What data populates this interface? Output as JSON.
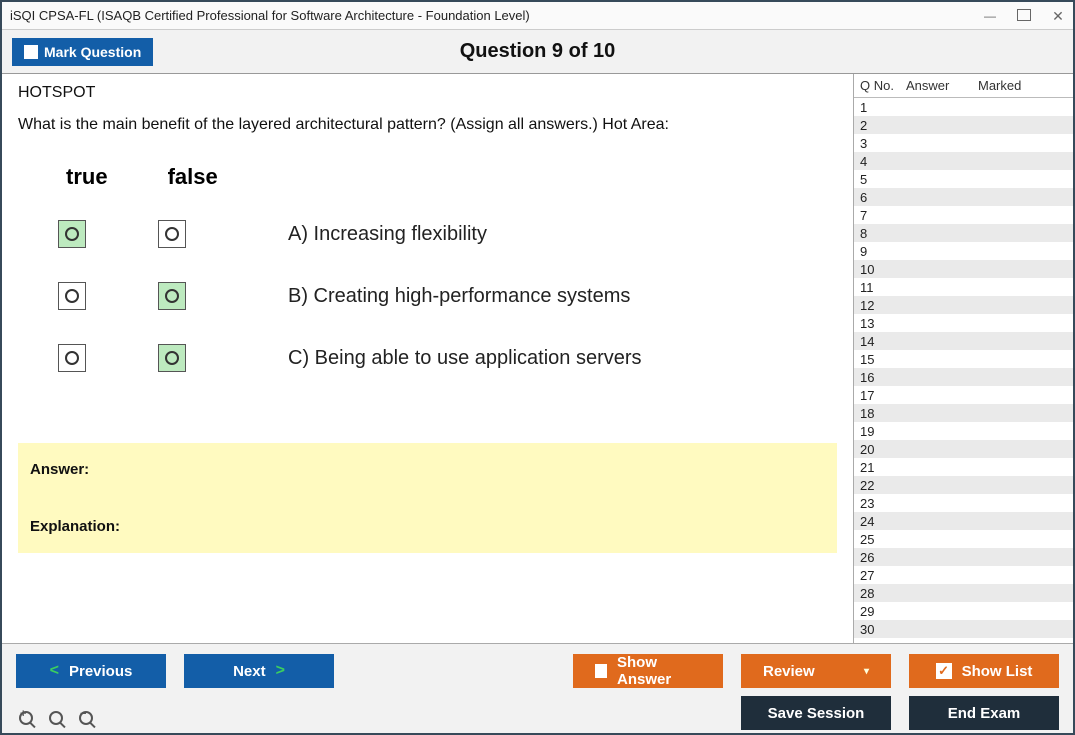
{
  "window": {
    "title": "iSQI CPSA-FL (ISAQB Certified Professional for Software Architecture - Foundation Level)"
  },
  "header": {
    "mark_question": "Mark Question",
    "question_counter": "Question 9 of 10"
  },
  "question": {
    "hotspot_label": "HOTSPOT",
    "text": "What is the main benefit of the layered architectural pattern? (Assign all answers.) Hot Area:",
    "col_true": "true",
    "col_false": "false",
    "options": [
      {
        "label": "A) Increasing flexibility",
        "true_selected": true,
        "false_selected": false
      },
      {
        "label": "B) Creating high-performance systems",
        "true_selected": false,
        "false_selected": true
      },
      {
        "label": "C) Being able to use application servers",
        "true_selected": false,
        "false_selected": true
      }
    ]
  },
  "answerbox": {
    "answer_label": "Answer:",
    "explanation_label": "Explanation:"
  },
  "qlist": {
    "header": {
      "qno": "Q No.",
      "answer": "Answer",
      "marked": "Marked"
    },
    "rows": [
      "1",
      "2",
      "3",
      "4",
      "5",
      "6",
      "7",
      "8",
      "9",
      "10",
      "11",
      "12",
      "13",
      "14",
      "15",
      "16",
      "17",
      "18",
      "19",
      "20",
      "21",
      "22",
      "23",
      "24",
      "25",
      "26",
      "27",
      "28",
      "29",
      "30"
    ]
  },
  "footer": {
    "previous": "Previous",
    "next": "Next",
    "show_answer": "Show Answer",
    "review": "Review",
    "show_list": "Show List",
    "save_session": "Save Session",
    "end_exam": "End Exam"
  }
}
